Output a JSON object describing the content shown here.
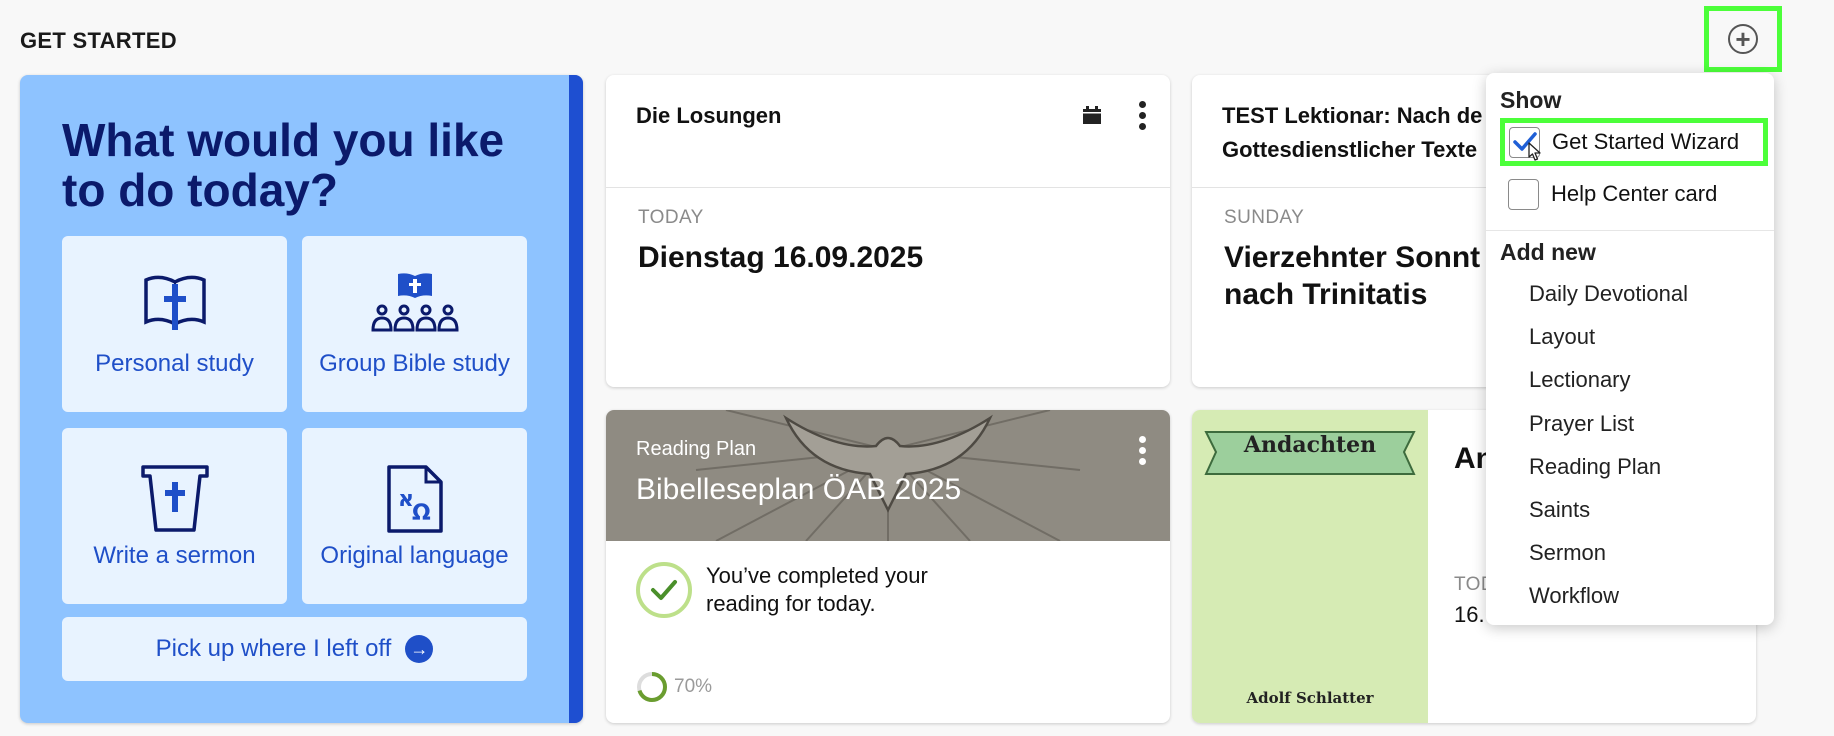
{
  "section": {
    "title": "GET STARTED"
  },
  "header": {
    "add_icon": "plus-circle-icon"
  },
  "wizard": {
    "heading": "What would you like to do today?",
    "tiles": [
      {
        "label": "Personal study",
        "icon": "open-bible-cross-icon"
      },
      {
        "label": "Group Bible study",
        "icon": "group-bible-icon"
      },
      {
        "label": "Write a sermon",
        "icon": "pulpit-cross-icon"
      },
      {
        "label": "Original language",
        "icon": "document-hebrew-greek-icon"
      }
    ],
    "pickup_label": "Pick up where I left off",
    "accent": "#1e4fd1",
    "background": "#8ec3ff"
  },
  "cards": {
    "losungen": {
      "title": "Die Losungen",
      "overline": "TODAY",
      "date": "Dienstag 16.09.2025"
    },
    "lectionary": {
      "title_line1": "TEST Lektionar: Nach de",
      "title_line2": "Gottesdienstlicher Texte",
      "overline": "SUNDAY",
      "headline_line1": "Vierzehnter Sonnt",
      "headline_line2": "nach Trinitatis"
    },
    "reading_plan": {
      "overline": "Reading Plan",
      "title": "Bibelleseplan ÖAB 2025",
      "status_line1": "You’ve completed your",
      "status_line2": "reading for today.",
      "progress_text": "70%",
      "progress": 0.7
    },
    "andachten": {
      "cover_title": "Andachten",
      "cover_author": "Adolf Schlatter",
      "title_partial": "An",
      "overline_partial": "TOD",
      "date_partial": "16."
    }
  },
  "menu": {
    "show_heading": "Show",
    "options": [
      {
        "label": "Get Started Wizard",
        "checked": true
      },
      {
        "label": "Help Center card",
        "checked": false
      }
    ],
    "add_heading": "Add new",
    "add_items": [
      "Daily Devotional",
      "Layout",
      "Lectionary",
      "Prayer List",
      "Reading Plan",
      "Saints",
      "Sermon",
      "Workflow"
    ]
  }
}
